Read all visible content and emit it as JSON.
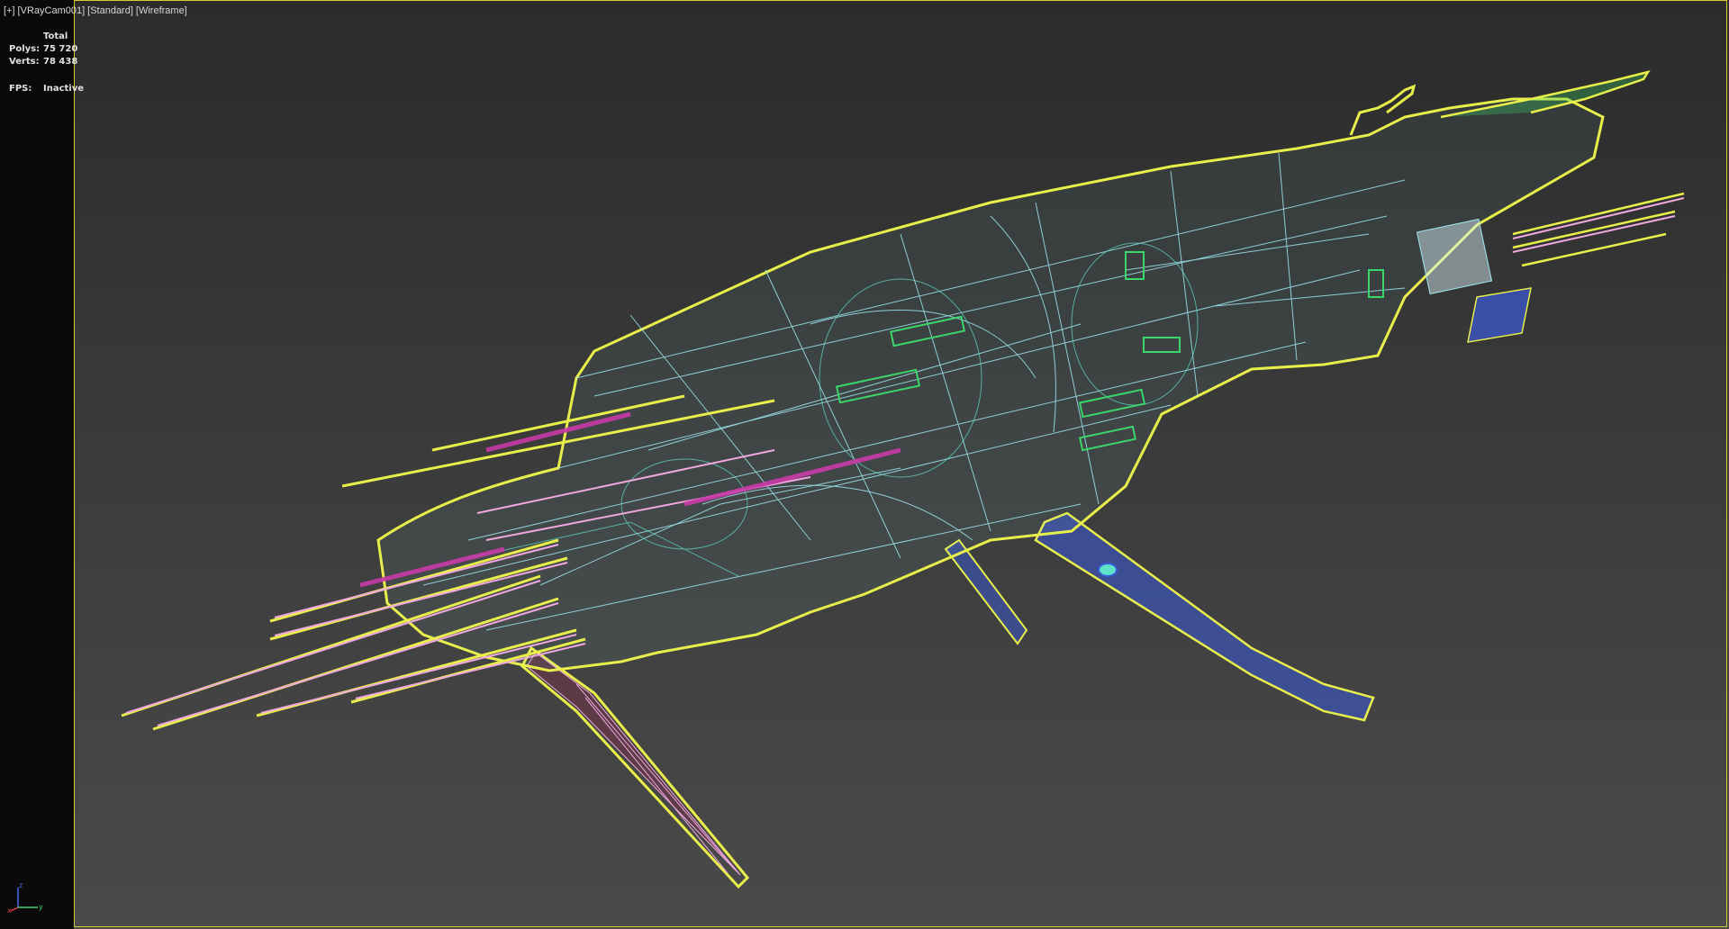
{
  "viewport": {
    "label_parts": [
      "[+]",
      "[VRayCam001]",
      "[Standard]",
      "[Wireframe]"
    ]
  },
  "stats": {
    "header": "Total",
    "polys_label": "Polys:",
    "polys_value": "75 720",
    "verts_label": "Verts:",
    "verts_value": "78 438",
    "fps_label": "FPS:",
    "fps_value": "Inactive"
  },
  "axis": {
    "x_label": "x",
    "y_label": "y",
    "z_label": "z"
  },
  "colors": {
    "background_top": "#2b2b2b",
    "background_bottom": "#4a4a4a",
    "safe_frame": "#d8c83a",
    "selection_outline": "#e8ee4a",
    "wire_cyan": "#9ee8f0",
    "wire_teal": "#5fe0c8",
    "wire_green": "#3bd66a",
    "wire_magenta": "#c93aa8",
    "wire_pink": "#f0a8e0",
    "wire_blue": "#3a5ad8",
    "wire_maroon": "#8a2a4a"
  }
}
